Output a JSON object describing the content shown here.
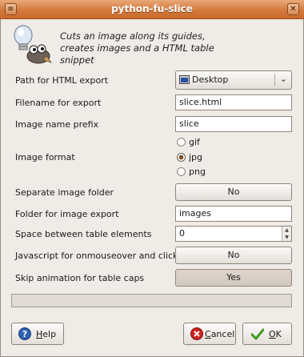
{
  "window": {
    "title": "python-fu-slice"
  },
  "header": {
    "description": "Cuts an image along its guides, creates images and a HTML table snippet"
  },
  "fields": {
    "html_path": {
      "label": "Path for HTML export",
      "value": "Desktop"
    },
    "filename": {
      "label": "Filename for export",
      "value": "slice.html"
    },
    "prefix": {
      "label": "Image name prefix",
      "value": "slice"
    },
    "format": {
      "label": "Image format",
      "options": [
        "gif",
        "jpg",
        "png"
      ],
      "selected": "jpg"
    },
    "separate_folder": {
      "label": "Separate image folder",
      "value": "No"
    },
    "image_folder": {
      "label": "Folder for image export",
      "value": "images"
    },
    "spacing": {
      "label": "Space between table elements",
      "value": "0"
    },
    "javascript": {
      "label": "Javascript for onmouseover and clicked",
      "value": "No"
    },
    "skip_animation": {
      "label": "Skip animation for table caps",
      "value": "Yes"
    }
  },
  "progress": {
    "fraction": 0
  },
  "buttons": {
    "help": "Help",
    "cancel": "Cancel",
    "ok": "OK"
  },
  "colors": {
    "titlebar": "#d47a3e",
    "dialog_bg": "#efebe7"
  }
}
